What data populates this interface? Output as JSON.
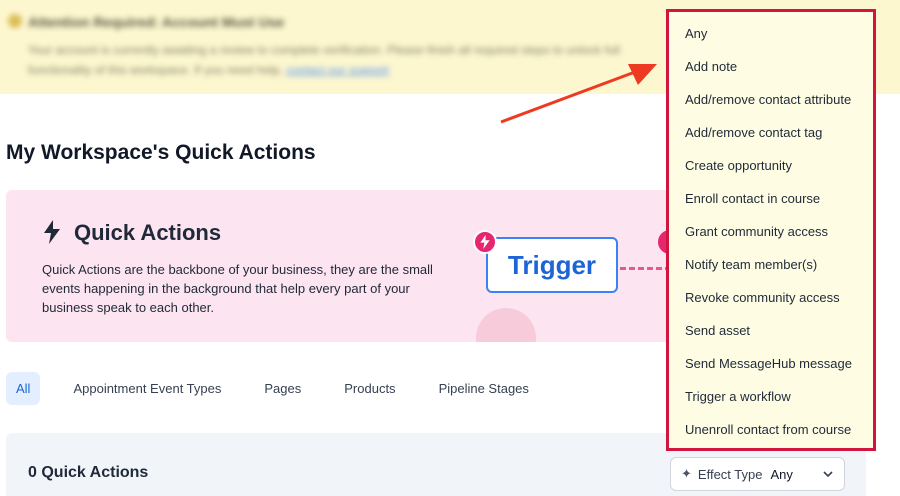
{
  "banner": {
    "title": "Attention Required: Account Must Use",
    "text": "Your account is currently awaiting a review to complete verification. Please finish all required steps to unlock full functionality of this workspace. If you need help,",
    "link": "contact our support"
  },
  "page_title": "My Workspace's Quick Actions",
  "hero": {
    "title": "Quick Actions",
    "description": "Quick Actions are the backbone of your business, they are the small events happening in the background that help every part of your business speak to each other.",
    "trigger_label": "Trigger"
  },
  "tabs": [
    {
      "label": "All",
      "active": true
    },
    {
      "label": "Appointment Event Types"
    },
    {
      "label": "Pages"
    },
    {
      "label": "Products"
    },
    {
      "label": "Pipeline Stages"
    }
  ],
  "panel": {
    "count_label": "0 Quick Actions"
  },
  "effect_select": {
    "label": "Effect Type",
    "value": "Any"
  },
  "dropdown": {
    "options": [
      "Any",
      "Add note",
      "Add/remove contact attribute",
      "Add/remove contact tag",
      "Create opportunity",
      "Enroll contact in course",
      "Grant community access",
      "Notify team member(s)",
      "Revoke community access",
      "Send asset",
      "Send MessageHub message",
      "Trigger a workflow",
      "Unenroll contact from course"
    ]
  },
  "colors": {
    "accent_blue": "#1e63d6",
    "highlight_red": "#d0163e",
    "hero_pink": "#fce4f1",
    "banner_yellow": "#fdf7cf"
  }
}
